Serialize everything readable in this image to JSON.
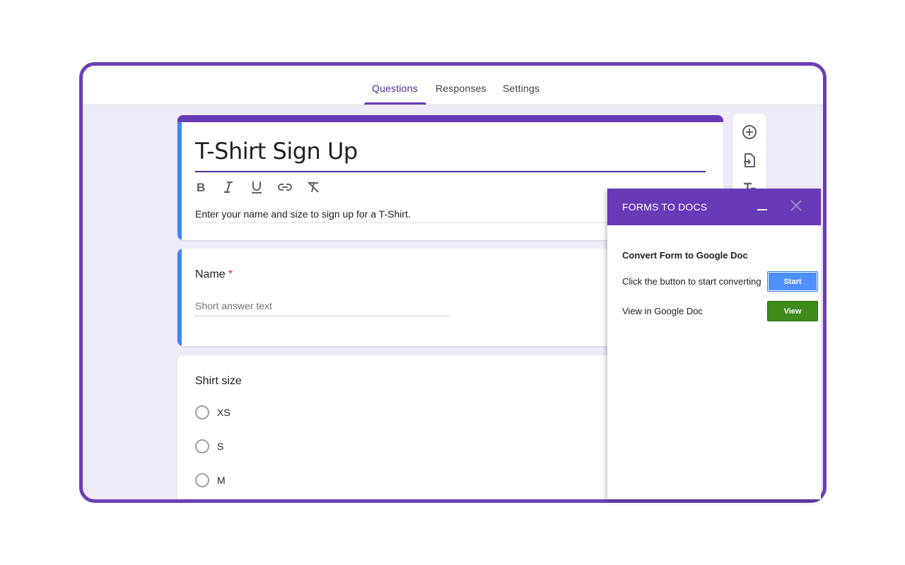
{
  "tabs": [
    {
      "label": "Questions",
      "active": true
    },
    {
      "label": "Responses",
      "active": false
    },
    {
      "label": "Settings",
      "active": false
    }
  ],
  "form": {
    "title": "T-Shirt Sign Up",
    "description": "Enter your name and size to sign up for a T-Shirt.",
    "format_icons": [
      "bold-icon",
      "italic-icon",
      "underline-icon",
      "link-icon",
      "clear-format-icon"
    ]
  },
  "questions": {
    "name": {
      "title": "Name",
      "required_mark": "*",
      "placeholder": "Short answer text"
    },
    "shirt_size": {
      "title": "Shirt size",
      "options": [
        "XS",
        "S",
        "M"
      ]
    }
  },
  "side_toolbar": {
    "icons": [
      "add-question-icon",
      "import-questions-icon",
      "add-title-icon"
    ]
  },
  "addon_panel": {
    "title": "FORMS TO DOCS",
    "heading": "Convert Form to Google Doc",
    "start_text": "Click the button to start converting",
    "start_label": "Start",
    "view_text": "View in Google Doc",
    "view_label": "View"
  },
  "colors": {
    "brand_purple": "#673ab7",
    "selected_blue": "#4285f4",
    "start_blue": "#4d90fe",
    "view_green": "#3d8b1d",
    "required_red": "#d93025"
  }
}
